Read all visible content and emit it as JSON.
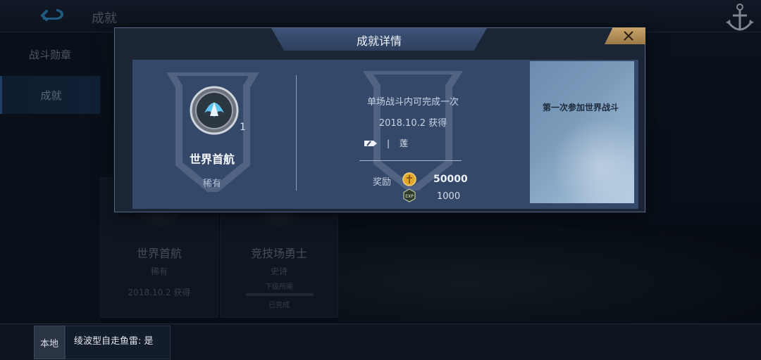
{
  "header": {
    "title": "成就"
  },
  "sidebar": {
    "items": [
      {
        "label": "战斗勋章"
      },
      {
        "label": "成就"
      }
    ]
  },
  "achievement_grid": {
    "cards": [
      {
        "name": "世界首航",
        "rarity": "稀有",
        "date": "2018.10.2 获得"
      },
      {
        "name": "竞技场勇士",
        "rarity": "史诗",
        "progress_label": "下级所需",
        "status": "已完成"
      }
    ]
  },
  "modal": {
    "title": "成就详情",
    "medal": {
      "name": "世界首航",
      "rarity": "稀有",
      "count": "1"
    },
    "condition": "单场战斗内可完成一次",
    "date": "2018.10.2 获得",
    "record": {
      "separator": "|",
      "ship": "莲"
    },
    "reward": {
      "label": "奖励",
      "coin_value": "50000",
      "exp_value": "1000"
    },
    "description": "第一次参加世界战斗"
  },
  "chat": {
    "channel": "本地",
    "message": "绫波型自走鱼雷: 是"
  },
  "icons": {
    "back": "back-arrow-icon",
    "anchor": "anchor-icon",
    "close": "close-icon",
    "coin": "gold-coin-icon",
    "exp": "exp-icon"
  },
  "colors": {
    "accent": "#3d5377",
    "close_button": "#c9a46a",
    "back_icon": "#3aa0e0"
  }
}
